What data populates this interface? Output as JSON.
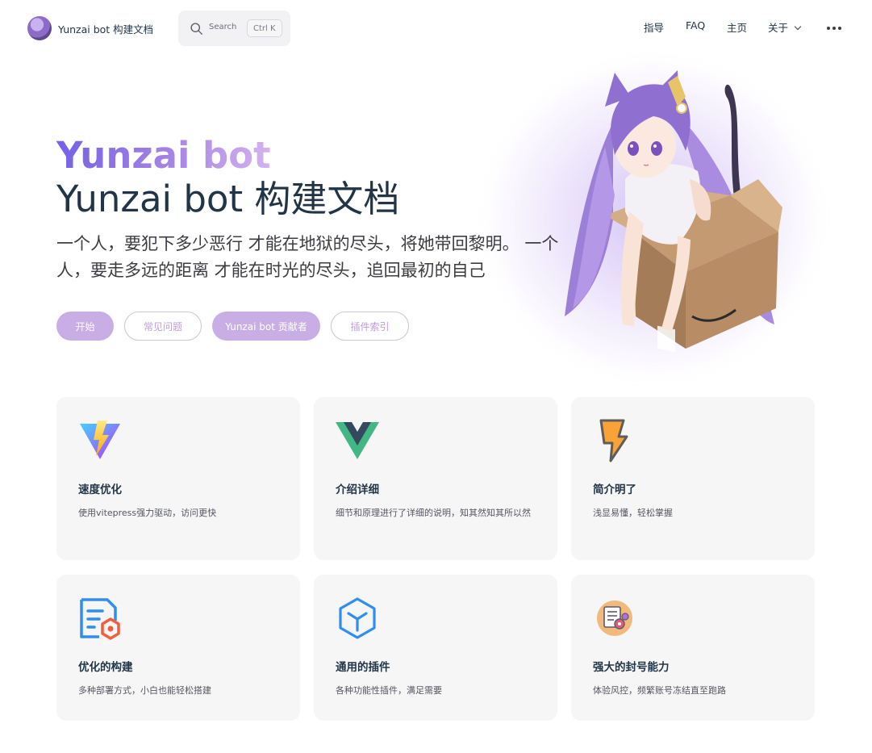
{
  "nav": {
    "site_title": "Yunzai bot 构建文档",
    "search_placeholder": "Search",
    "search_shortcut": "Ctrl K",
    "links": [
      "指导",
      "FAQ",
      "主页",
      "关于"
    ]
  },
  "hero": {
    "name": "Yunzai bot",
    "text": "Yunzai bot  构建文档",
    "tagline": "一个人，要犯下多少恶行 才能在地狱的尽头，将她带回黎明。 一个人，要走多远的距离 才能在时光的尽头，追回最初的自己",
    "actions": [
      {
        "label": "开始",
        "theme": "brand"
      },
      {
        "label": "常见问题",
        "theme": "alt"
      },
      {
        "label": "Yunzai bot 贡献者",
        "theme": "brand"
      },
      {
        "label": "插件索引",
        "theme": "alt"
      }
    ]
  },
  "features": [
    {
      "icon": "vite-lightning-icon",
      "title": "速度优化",
      "details": "使用vitepress强力驱动，访问更快"
    },
    {
      "icon": "vue-logo-icon",
      "title": "介绍详细",
      "details": "细节和原理进行了详细的说明，知其然知其所以然"
    },
    {
      "icon": "lightning-bolt-icon",
      "title": "简介明了",
      "details": "浅显易懂，轻松掌握"
    },
    {
      "icon": "document-build-icon",
      "title": "优化的构建",
      "details": "多种部署方式，小白也能轻松搭建"
    },
    {
      "icon": "cube-plugin-icon",
      "title": "通用的插件",
      "details": "各种功能性插件，满足需要"
    },
    {
      "icon": "settings-document-icon",
      "title": "强大的封号能力",
      "details": "体验风控，频繁账号冻结直至跑路"
    }
  ],
  "colors": {
    "brand": "#c9aee6",
    "brand_text": "#bf9de0",
    "gradient_start": "#7461e6",
    "gradient_end": "#d4b3ee",
    "card_bg": "#f6f6f7"
  }
}
